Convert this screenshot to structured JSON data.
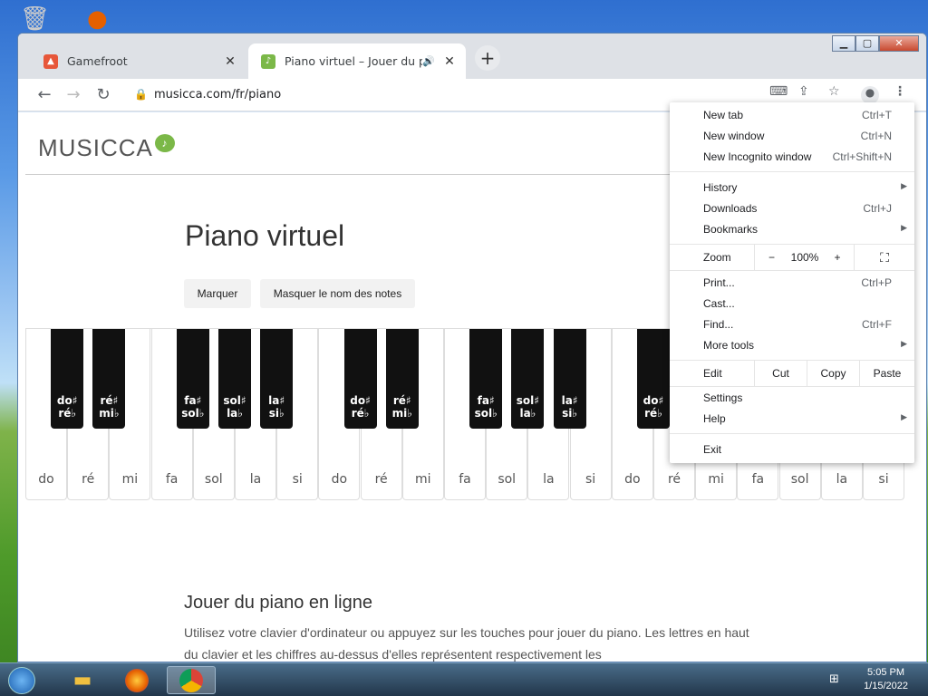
{
  "tabs": [
    {
      "title": "Gamefroot",
      "icon": "gamefroot-icon"
    },
    {
      "title": "Piano virtuel – Jouer du piano",
      "icon": "musicca-icon",
      "audio": true
    }
  ],
  "toolbar": {
    "url": "musicca.com/fr/piano"
  },
  "page": {
    "logo": "MUSICCA",
    "title": "Piano virtuel",
    "buttons": [
      "Marquer",
      "Masquer le nom des notes"
    ],
    "white_keys": [
      "do",
      "ré",
      "mi",
      "fa",
      "sol",
      "la",
      "si",
      "do",
      "ré",
      "mi",
      "fa",
      "sol",
      "la",
      "si",
      "do",
      "ré",
      "mi",
      "fa",
      "sol",
      "la",
      "si"
    ],
    "black_keys": [
      [
        "do♯",
        "ré♭"
      ],
      [
        "ré♯",
        "mi♭"
      ],
      [
        "fa♯",
        "sol♭"
      ],
      [
        "sol♯",
        "la♭"
      ],
      [
        "la♯",
        "si♭"
      ],
      [
        "do♯",
        "ré♭"
      ],
      [
        "ré♯",
        "mi♭"
      ],
      [
        "fa♯",
        "sol♭"
      ],
      [
        "sol♯",
        "la♭"
      ],
      [
        "la♯",
        "si♭"
      ],
      [
        "do♯",
        "ré♭"
      ]
    ],
    "section_title": "Jouer du piano en ligne",
    "paragraph": "Utilisez votre clavier d'ordinateur ou appuyez sur les touches pour jouer du piano. Les lettres en haut du clavier et les chiffres au-dessus d'elles représentent respectivement les"
  },
  "menu": {
    "new_tab": {
      "label": "New tab",
      "shortcut": "Ctrl+T"
    },
    "new_window": {
      "label": "New window",
      "shortcut": "Ctrl+N"
    },
    "incognito": {
      "label": "New Incognito window",
      "shortcut": "Ctrl+Shift+N"
    },
    "history": "History",
    "downloads": {
      "label": "Downloads",
      "shortcut": "Ctrl+J"
    },
    "bookmarks": "Bookmarks",
    "zoom": {
      "label": "Zoom",
      "minus": "−",
      "value": "100%",
      "plus": "+"
    },
    "print": {
      "label": "Print...",
      "shortcut": "Ctrl+P"
    },
    "cast": "Cast...",
    "find": {
      "label": "Find...",
      "shortcut": "Ctrl+F"
    },
    "more_tools": "More tools",
    "edit": {
      "label": "Edit",
      "cut": "Cut",
      "copy": "Copy",
      "paste": "Paste"
    },
    "settings": "Settings",
    "help": "Help",
    "exit": "Exit"
  },
  "taskbar": {
    "time": "5:05 PM",
    "date": "1/15/2022"
  }
}
